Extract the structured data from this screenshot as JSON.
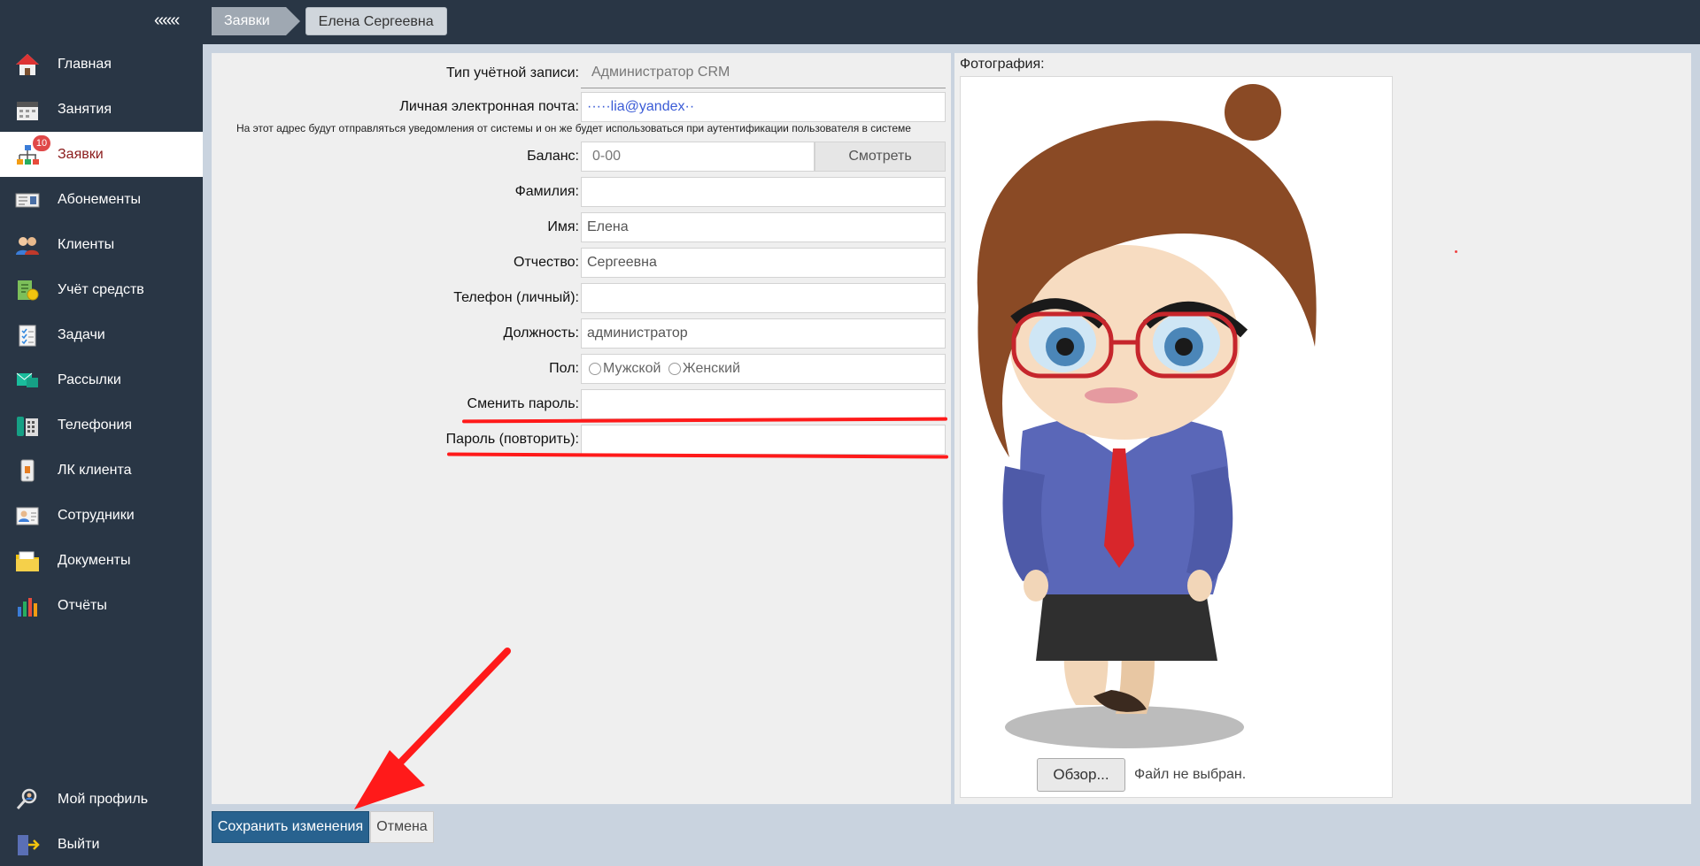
{
  "sidebar": {
    "collapse_label": "«««",
    "items": [
      {
        "label": "Главная",
        "icon": "home-icon"
      },
      {
        "label": "Занятия",
        "icon": "calendar-icon"
      },
      {
        "label": "Заявки",
        "icon": "org-chart-icon",
        "badge": "10"
      },
      {
        "label": "Абонементы",
        "icon": "ticket-icon"
      },
      {
        "label": "Клиенты",
        "icon": "clients-icon"
      },
      {
        "label": "Учёт средств",
        "icon": "money-icon"
      },
      {
        "label": "Задачи",
        "icon": "checklist-icon"
      },
      {
        "label": "Рассылки",
        "icon": "mailing-icon"
      },
      {
        "label": "Телефония",
        "icon": "phone-icon"
      },
      {
        "label": "ЛК клиента",
        "icon": "client-cabinet-icon"
      },
      {
        "label": "Сотрудники",
        "icon": "staff-icon"
      },
      {
        "label": "Документы",
        "icon": "folder-icon"
      },
      {
        "label": "Отчёты",
        "icon": "bar-chart-icon"
      }
    ],
    "bottom": [
      {
        "label": "Мой профиль",
        "icon": "profile-search-icon"
      },
      {
        "label": "Выйти",
        "icon": "logout-icon"
      }
    ]
  },
  "breadcrumbs": [
    "Заявки",
    "Елена Сергеевна"
  ],
  "form": {
    "account_type_label": "Тип учётной записи:",
    "account_type_value": "Администратор CRM",
    "email_label": "Личная электронная почта:",
    "email_value": "·····lia@yandex··",
    "email_hint": "На этот адрес будут отправляться уведомления от системы и он же будет использоваться при аутентификации пользователя в системе",
    "balance_label": "Баланс:",
    "balance_value": "0-00",
    "balance_button": "Смотреть",
    "surname_label": "Фамилия:",
    "surname_value": "",
    "name_label": "Имя:",
    "name_value": "Елена",
    "patronymic_label": "Отчество:",
    "patronymic_value": "Сергеевна",
    "phone_label": "Телефон (личный):",
    "phone_value": "",
    "position_label": "Должность:",
    "position_value": "администратор",
    "gender_label": "Пол:",
    "gender_male": "Мужской",
    "gender_female": "Женский",
    "password_label": "Сменить пароль:",
    "password_repeat_label": "Пароль (повторить):"
  },
  "photo": {
    "label": "Фотография:",
    "browse_button": "Обзор...",
    "file_status": "Файл не выбран."
  },
  "actions": {
    "save": "Сохранить изменения",
    "cancel": "Отмена"
  },
  "colors": {
    "sidebar_bg": "#293645",
    "active_text": "#8b1b1b",
    "save_bg": "#28628f",
    "annotation_red": "#ff1a1a"
  }
}
